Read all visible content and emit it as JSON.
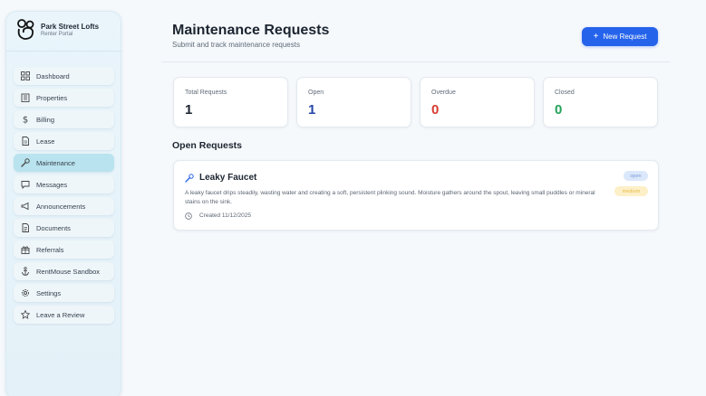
{
  "brand": {
    "name": "Park Street Lofts",
    "subtitle": "Renter Portal"
  },
  "sidebar": {
    "items": [
      {
        "label": "Dashboard",
        "icon": "grid-icon",
        "active": false
      },
      {
        "label": "Properties",
        "icon": "building-icon",
        "active": false
      },
      {
        "label": "Billing",
        "icon": "dollar-icon",
        "active": false
      },
      {
        "label": "Lease",
        "icon": "document-icon",
        "active": false
      },
      {
        "label": "Maintenance",
        "icon": "wrench-icon",
        "active": true
      },
      {
        "label": "Messages",
        "icon": "message-icon",
        "active": false
      },
      {
        "label": "Announcements",
        "icon": "megaphone-icon",
        "active": false
      },
      {
        "label": "Documents",
        "icon": "file-icon",
        "active": false
      },
      {
        "label": "Referrals",
        "icon": "gift-icon",
        "active": false
      },
      {
        "label": "RentMouse Sandbox",
        "icon": "anchor-icon",
        "active": false
      },
      {
        "label": "Settings",
        "icon": "gear-icon",
        "active": false
      },
      {
        "label": "Leave a Review",
        "icon": "star-icon",
        "active": false
      }
    ]
  },
  "header": {
    "title": "Maintenance Requests",
    "subtitle": "Submit and track maintenance requests",
    "new_button_label": "New Request"
  },
  "stats": [
    {
      "label": "Total Requests",
      "value": "1",
      "color": "#1c2530"
    },
    {
      "label": "Open",
      "value": "1",
      "color": "#2746a8"
    },
    {
      "label": "Overdue",
      "value": "0",
      "color": "#d63a2f"
    },
    {
      "label": "Closed",
      "value": "0",
      "color": "#22a35a"
    }
  ],
  "open_requests": {
    "section_title": "Open Requests",
    "items": [
      {
        "title": "Leaky Faucet",
        "status": "open",
        "priority": "medium",
        "description": "A leaky faucet drips steadily, wasting water and creating a soft, persistent plinking sound. Moisture gathers around the spout, leaving small puddles or mineral stains on the sink.",
        "created": "Created 11/12/2025"
      }
    ]
  },
  "colors": {
    "accent": "#2563eb",
    "active_nav": "#b9e3ee"
  }
}
